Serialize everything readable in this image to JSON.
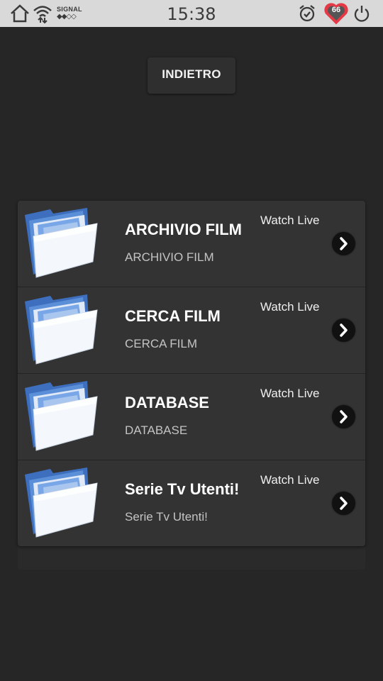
{
  "status_bar": {
    "signal_label": "SIGNAL",
    "signal_dots": "◆◆◇◇",
    "time": "15:38",
    "battery_level": "66",
    "icons": [
      "home-icon",
      "wifi-icon",
      "alarm-icon",
      "heart-battery-icon",
      "power-icon"
    ]
  },
  "back_button": {
    "label": "INDIETRO"
  },
  "items": [
    {
      "title": "ARCHIVIO FILM",
      "subtitle": "ARCHIVIO FILM",
      "action": "Watch Live",
      "icon": "folder-icon"
    },
    {
      "title": "CERCA FILM",
      "subtitle": "CERCA FILM",
      "action": "Watch Live",
      "icon": "folder-icon"
    },
    {
      "title": "DATABASE",
      "subtitle": "DATABASE",
      "action": "Watch Live",
      "icon": "folder-icon"
    },
    {
      "title": "Serie Tv Utenti!",
      "subtitle": "Serie Tv Utenti!",
      "action": "Watch Live",
      "icon": "folder-icon"
    }
  ],
  "colors": {
    "background": "#262626",
    "status_bar": "#d9d9d9",
    "list_background": "#333333",
    "folder_blue": "#5b8fd8",
    "heart_red": "#e53945"
  }
}
